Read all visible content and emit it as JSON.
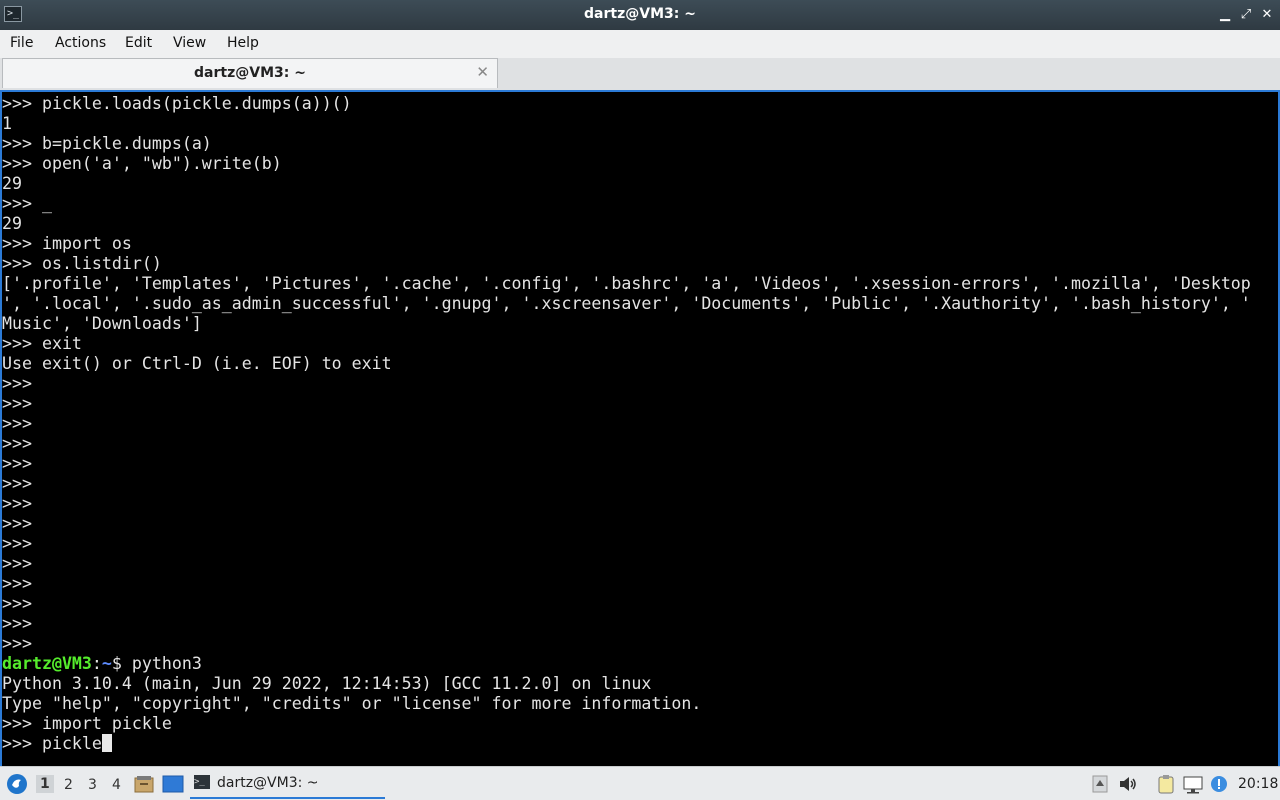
{
  "window": {
    "title": "dartz@VM3: ~",
    "app_icon": ">_"
  },
  "window_buttons": {
    "minimize": "▁",
    "maximize": "⤢",
    "close": "✕"
  },
  "menu": {
    "items": [
      "File",
      "Actions",
      "Edit",
      "View",
      "Help"
    ]
  },
  "tab": {
    "label": "dartz@VM3: ~",
    "close": "✕"
  },
  "terminal": {
    "lines": [
      ">>> pickle.loads(pickle.dumps(a))()",
      "1",
      ">>> b=pickle.dumps(a)",
      ">>> open('a', \"wb\").write(b)",
      "29",
      ">>> _",
      "29",
      ">>> import os",
      ">>> os.listdir()",
      "['.profile', 'Templates', 'Pictures', '.cache', '.config', '.bashrc', 'a', 'Videos', '.xsession-errors', '.mozilla', 'Desktop",
      "', '.local', '.sudo_as_admin_successful', '.gnupg', '.xscreensaver', 'Documents', 'Public', '.Xauthority', '.bash_history', '",
      "Music', 'Downloads']",
      ">>> exit",
      "Use exit() or Ctrl-D (i.e. EOF) to exit",
      ">>>",
      ">>>",
      ">>>",
      ">>>",
      ">>>",
      ">>>",
      ">>>",
      ">>>",
      ">>>",
      ">>>",
      ">>>",
      ">>>",
      ">>>",
      ">>>"
    ],
    "prompt": {
      "user_host": "dartz@VM3",
      "sep": ":",
      "path": "~",
      "symbol": "$ ",
      "command": "python3"
    },
    "after_lines": [
      "Python 3.10.4 (main, Jun 29 2022, 12:14:53) [GCC 11.2.0] on linux",
      "Type \"help\", \"copyright\", \"credits\" or \"license\" for more information.",
      ">>> import pickle"
    ],
    "current_input": ">>> pickle"
  },
  "taskbar": {
    "workspaces": [
      "1",
      "2",
      "3",
      "4"
    ],
    "active_workspace": "1",
    "task_label": "dartz@VM3: ~",
    "clock": "20:18"
  },
  "colors": {
    "accent": "#2b7ad6",
    "prompt_user": "#55ec2c",
    "prompt_path": "#5e8cff"
  }
}
